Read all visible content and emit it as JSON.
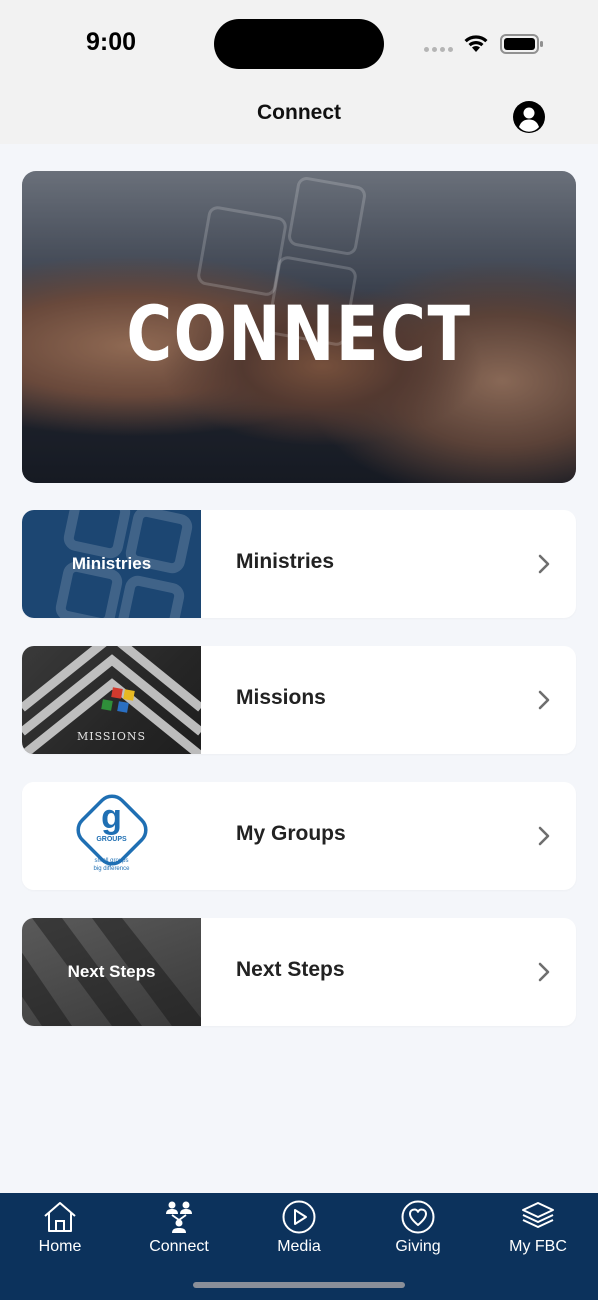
{
  "status_bar": {
    "time": "9:00",
    "icons": [
      "signal-icon",
      "wifi-icon",
      "battery-icon"
    ]
  },
  "header": {
    "title": "Connect",
    "profile_icon": "person-circle-icon"
  },
  "hero": {
    "title": "CONNECT"
  },
  "list": {
    "items": [
      {
        "label": "Ministries",
        "thumb_label": "Ministries",
        "chevron": "chevron-right-icon"
      },
      {
        "label": "Missions",
        "thumb_label": "MISSIONS",
        "chevron": "chevron-right-icon"
      },
      {
        "label": "My Groups",
        "thumb_label": "GROUPS",
        "thumb_letter": "g",
        "thumb_tagline_1": "small groups",
        "thumb_tagline_2": "big difference",
        "chevron": "chevron-right-icon"
      },
      {
        "label": "Next Steps",
        "thumb_label": "Next Steps",
        "chevron": "chevron-right-icon"
      }
    ]
  },
  "tab_bar": {
    "tabs": [
      {
        "label": "Home",
        "icon": "home-icon"
      },
      {
        "label": "Connect",
        "icon": "people-icon"
      },
      {
        "label": "Media",
        "icon": "play-circle-icon"
      },
      {
        "label": "Giving",
        "icon": "heart-circle-icon"
      },
      {
        "label": "My FBC",
        "icon": "layers-icon"
      }
    ]
  },
  "colors": {
    "tab_bar_bg": "#0c325c",
    "ministries_bg": "#1c4672",
    "groups_blue": "#1f6fb3",
    "page_bg": "#f4f6fa"
  }
}
